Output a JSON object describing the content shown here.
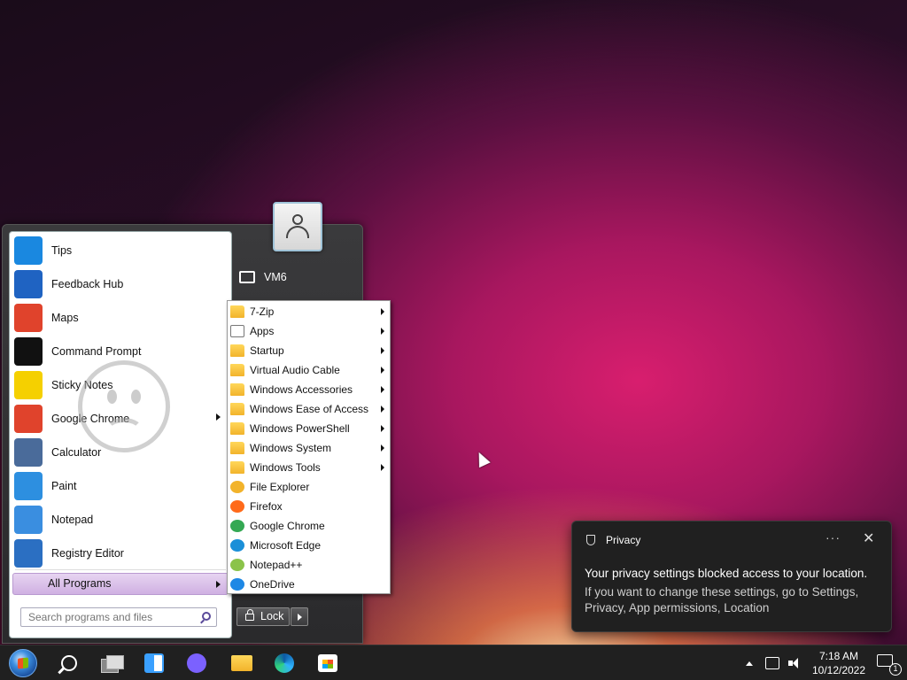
{
  "start_menu": {
    "programs": [
      {
        "label": "Tips",
        "icon": "tips-icon",
        "color": "#1a88e0",
        "has_submenu": false
      },
      {
        "label": "Feedback Hub",
        "icon": "feedback-hub-icon",
        "color": "#1f63c2",
        "has_submenu": false
      },
      {
        "label": "Maps",
        "icon": "maps-icon",
        "color": "#e0432c",
        "has_submenu": false
      },
      {
        "label": "Command Prompt",
        "icon": "command-prompt-icon",
        "color": "#111111",
        "has_submenu": false
      },
      {
        "label": "Sticky Notes",
        "icon": "sticky-notes-icon",
        "color": "#f5d000",
        "has_submenu": false
      },
      {
        "label": "Google Chrome",
        "icon": "chrome-icon",
        "color": "#e0432c",
        "has_submenu": true
      },
      {
        "label": "Calculator",
        "icon": "calculator-icon",
        "color": "#4a6b9a",
        "has_submenu": false
      },
      {
        "label": "Paint",
        "icon": "paint-icon",
        "color": "#2d8fe0",
        "has_submenu": false
      },
      {
        "label": "Notepad",
        "icon": "notepad-icon",
        "color": "#3a8ee0",
        "has_submenu": false
      },
      {
        "label": "Registry Editor",
        "icon": "registry-editor-icon",
        "color": "#2b6fc2",
        "has_submenu": false
      }
    ],
    "all_programs": "All Programs",
    "search_placeholder": "Search programs and files",
    "user_name": "VM6",
    "lock_label": "Lock"
  },
  "submenu": {
    "items": [
      {
        "label": "7-Zip",
        "icon": "folder-icon",
        "kind": "folder",
        "has_submenu": true
      },
      {
        "label": "Apps",
        "icon": "apps-icon",
        "kind": "apps",
        "has_submenu": true
      },
      {
        "label": "Startup",
        "icon": "folder-icon",
        "kind": "folder",
        "has_submenu": true
      },
      {
        "label": "Virtual Audio Cable",
        "icon": "folder-icon",
        "kind": "folder",
        "has_submenu": true
      },
      {
        "label": "Windows Accessories",
        "icon": "folder-icon",
        "kind": "folder",
        "has_submenu": true
      },
      {
        "label": "Windows Ease of Access",
        "icon": "folder-icon",
        "kind": "folder",
        "has_submenu": true
      },
      {
        "label": "Windows PowerShell",
        "icon": "folder-icon",
        "kind": "folder",
        "has_submenu": true
      },
      {
        "label": "Windows System",
        "icon": "folder-icon",
        "kind": "folder",
        "has_submenu": true
      },
      {
        "label": "Windows Tools",
        "icon": "folder-icon",
        "kind": "folder",
        "has_submenu": true
      },
      {
        "label": "File Explorer",
        "icon": "file-explorer-icon",
        "kind": "app",
        "color": "#f2b32b",
        "has_submenu": false
      },
      {
        "label": "Firefox",
        "icon": "firefox-icon",
        "kind": "app",
        "color": "#ff6a1a",
        "has_submenu": false
      },
      {
        "label": "Google Chrome",
        "icon": "chrome-icon",
        "kind": "app",
        "color": "#34a853",
        "has_submenu": false
      },
      {
        "label": "Microsoft Edge",
        "icon": "edge-icon",
        "kind": "app",
        "color": "#1b8fd8",
        "has_submenu": false
      },
      {
        "label": "Notepad++",
        "icon": "notepad-plus-plus-icon",
        "kind": "app",
        "color": "#8bc34a",
        "has_submenu": false
      },
      {
        "label": "OneDrive",
        "icon": "onedrive-icon",
        "kind": "app",
        "color": "#1e88e5",
        "has_submenu": false
      }
    ]
  },
  "notification": {
    "app": "Privacy",
    "title": "Your privacy settings blocked access to your location.",
    "body": "If you want to change these settings, go to Settings, Privacy, App permissions, Location",
    "more_glyph": "···",
    "close_glyph": "✕"
  },
  "taskbar": {
    "time": "7:18 AM",
    "date": "10/12/2022",
    "notification_count": "1"
  }
}
